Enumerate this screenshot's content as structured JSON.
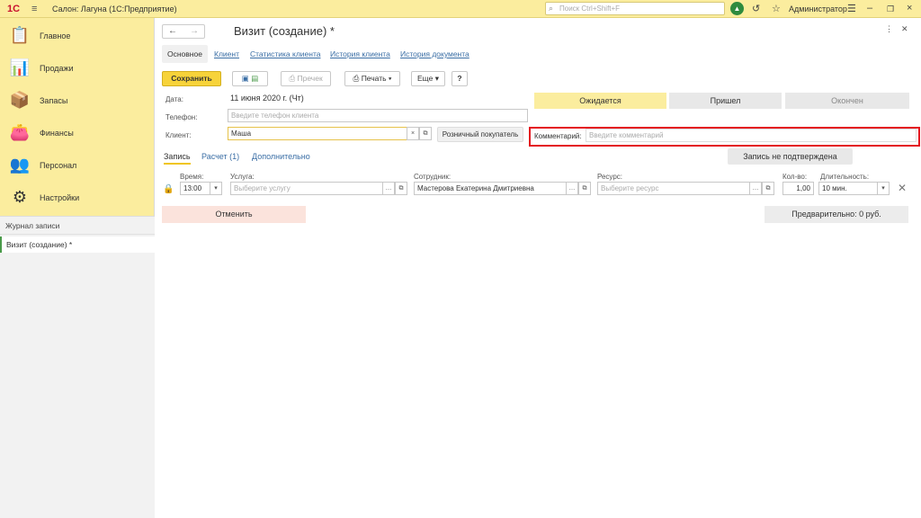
{
  "topbar": {
    "logo": "1С",
    "title": "Салон: Лагуна  (1С:Предприятие)",
    "search_placeholder": "Поиск Ctrl+Shift+F",
    "user": "Администратор"
  },
  "sidebar": {
    "items": [
      {
        "label": "Главное",
        "icon": "clipboard-icon"
      },
      {
        "label": "Продажи",
        "icon": "chart-icon"
      },
      {
        "label": "Запасы",
        "icon": "boxes-icon"
      },
      {
        "label": "Финансы",
        "icon": "wallet-icon"
      },
      {
        "label": "Персонал",
        "icon": "people-icon"
      },
      {
        "label": "Настройки",
        "icon": "gear-icon"
      }
    ],
    "open_windows_header": "Журнал записи",
    "open_window_item": "Визит (создание) *"
  },
  "form": {
    "title": "Визит (создание) *",
    "tabs": [
      "Основное",
      "Клиент",
      "Статистика клиента",
      "История клиента",
      "История документа"
    ],
    "toolbar": {
      "save": "Сохранить",
      "receipt": "Пречек",
      "print": "Печать",
      "more": "Еще",
      "help": "?"
    },
    "date_label": "Дата:",
    "date_value": "11 июня 2020 г. (Чт)",
    "phone_label": "Телефон:",
    "phone_placeholder": "Введите телефон клиента",
    "client_label": "Клиент:",
    "client_value": "Маша",
    "retail_button": "Розничный покупатель",
    "comment_label": "Комментарий:",
    "comment_placeholder": "Введите комментарий",
    "statuses": [
      "Ожидается",
      "Пришел",
      "Окончен"
    ],
    "not_confirmed": "Запись не подтверждена",
    "subtabs": [
      "Запись",
      "Расчет (1)",
      "Дополнительно"
    ],
    "columns": {
      "time": "Время:",
      "service": "Услуга:",
      "employee": "Сотрудник:",
      "resource": "Ресурс:",
      "qty": "Кол-во:",
      "duration": "Длительность:"
    },
    "row": {
      "time": "13:00",
      "service_placeholder": "Выберите услугу",
      "employee": "Мастерова Екатерина Дмитриевна",
      "resource_placeholder": "Выберите ресурс",
      "qty": "1,00",
      "duration": "10 мин."
    },
    "cancel": "Отменить",
    "prelim": "Предварительно: 0 руб."
  },
  "colors": {
    "accent_yellow": "#fbed9e",
    "save_yellow": "#f7d33a",
    "highlight_red": "#e4141e"
  }
}
